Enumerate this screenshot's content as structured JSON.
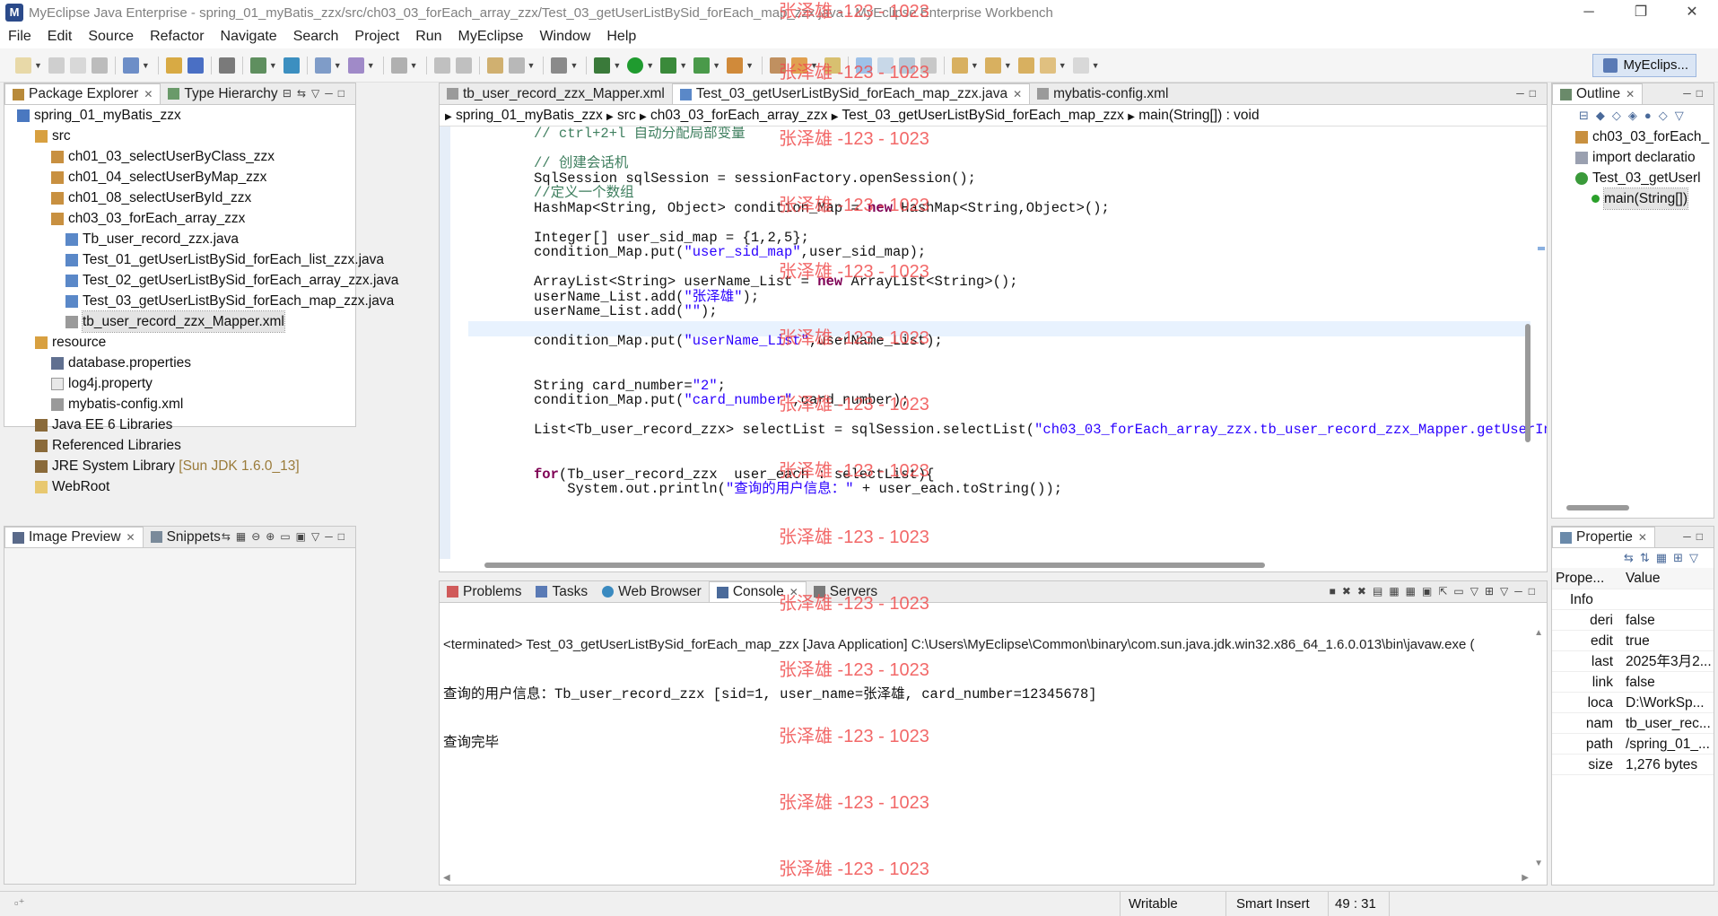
{
  "window": {
    "title": "MyEclipse Java Enterprise - spring_01_myBatis_zzx/src/ch03_03_forEach_array_zzx/Test_03_getUserListBySid_forEach_map_zzx.java - MyEclipse Enterprise Workbench",
    "minimize": "─",
    "maximize": "❐",
    "close": "✕"
  },
  "menu": [
    "File",
    "Edit",
    "Source",
    "Refactor",
    "Navigate",
    "Search",
    "Project",
    "Run",
    "MyEclipse",
    "Window",
    "Help"
  ],
  "toolbar": {
    "perspective": "MyEclips..."
  },
  "package_explorer": {
    "tabs": [
      "Package Explorer",
      "Type Hierarchy"
    ],
    "nodes": [
      {
        "label": "spring_01_myBatis_zzx"
      },
      {
        "label": "src"
      },
      {
        "label": "ch01_03_selectUserByClass_zzx"
      },
      {
        "label": "ch01_04_selectUserByMap_zzx"
      },
      {
        "label": "ch01_08_selectUserById_zzx"
      },
      {
        "label": "ch03_03_forEach_array_zzx"
      },
      {
        "label": "Tb_user_record_zzx.java"
      },
      {
        "label": "Test_01_getUserListBySid_forEach_list_zzx.java"
      },
      {
        "label": "Test_02_getUserListBySid_forEach_array_zzx.java"
      },
      {
        "label": "Test_03_getUserListBySid_forEach_map_zzx.java"
      },
      {
        "label": "tb_user_record_zzx_Mapper.xml"
      },
      {
        "label": "resource"
      },
      {
        "label": "database.properties"
      },
      {
        "label": "log4j.property"
      },
      {
        "label": "mybatis-config.xml"
      },
      {
        "label": "Java EE 6 Libraries"
      },
      {
        "label": "Referenced Libraries"
      },
      {
        "label": "JRE System Library",
        "hint": "[Sun JDK 1.6.0_13]"
      },
      {
        "label": "WebRoot"
      }
    ]
  },
  "image_preview": {
    "tabs": [
      "Image Preview",
      "Snippets"
    ]
  },
  "editor": {
    "tabs": [
      "tb_user_record_zzx_Mapper.xml",
      "Test_03_getUserListBySid_forEach_map_zzx.java",
      "mybatis-config.xml"
    ],
    "breadcrumb": [
      "spring_01_myBatis_zzx",
      "src",
      "ch03_03_forEach_array_zzx",
      "Test_03_getUserListBySid_forEach_map_zzx",
      "main(String[]) : void"
    ],
    "lines": [
      [
        {
          "t": "// ctrl+2+l 自动分配局部变量",
          "c": "cmt"
        }
      ],
      [
        {
          "t": "",
          "c": ""
        }
      ],
      [
        {
          "t": "// 创建会话机",
          "c": "cmt"
        }
      ],
      [
        {
          "t": "SqlSession sqlSession = sessionFactory.openSession();",
          "c": ""
        }
      ],
      [
        {
          "t": "//定义一个数组",
          "c": "cmt"
        }
      ],
      [
        {
          "t": "HashMap<String, Object> condition_Map = ",
          "c": ""
        },
        {
          "t": "new",
          "c": "kw"
        },
        {
          "t": " HashMap<String,Object>();",
          "c": ""
        }
      ],
      [
        {
          "t": "",
          "c": ""
        }
      ],
      [
        {
          "t": "Integer[] user_sid_map = {1,2,5};",
          "c": ""
        }
      ],
      [
        {
          "t": "condition_Map.put(",
          "c": ""
        },
        {
          "t": "\"user_sid_map\"",
          "c": "str"
        },
        {
          "t": ",user_sid_map);",
          "c": ""
        }
      ],
      [
        {
          "t": "",
          "c": ""
        }
      ],
      [
        {
          "t": "ArrayList<String> userName_List = ",
          "c": ""
        },
        {
          "t": "new",
          "c": "kw"
        },
        {
          "t": " ArrayList<String>();",
          "c": ""
        }
      ],
      [
        {
          "t": "userName_List.add(",
          "c": ""
        },
        {
          "t": "\"张泽雄\"",
          "c": "str"
        },
        {
          "t": ");",
          "c": ""
        }
      ],
      [
        {
          "t": "userName_List.add(",
          "c": ""
        },
        {
          "t": "\"\"",
          "c": "str"
        },
        {
          "t": ");",
          "c": ""
        }
      ],
      [
        {
          "t": "",
          "c": ""
        }
      ],
      [
        {
          "t": "condition_Map.put(",
          "c": ""
        },
        {
          "t": "\"userName_List\"",
          "c": "str"
        },
        {
          "t": ",userName_List);",
          "c": ""
        }
      ],
      [
        {
          "t": "",
          "c": ""
        }
      ],
      [
        {
          "t": "",
          "c": ""
        }
      ],
      [
        {
          "t": "String card_number=",
          "c": ""
        },
        {
          "t": "\"2\"",
          "c": "str"
        },
        {
          "t": ";",
          "c": ""
        }
      ],
      [
        {
          "t": "condition_Map.put(",
          "c": ""
        },
        {
          "t": "\"card_number\"",
          "c": "str"
        },
        {
          "t": ",card_number);",
          "c": ""
        }
      ],
      [
        {
          "t": "",
          "c": ""
        }
      ],
      [
        {
          "t": "List<Tb_user_record_zzx> selectList = sqlSession.selectList(",
          "c": ""
        },
        {
          "t": "\"ch03_03_forEach_array_zzx.tb_user_record_zzx_Mapper.getUserIn",
          "c": "str"
        }
      ],
      [
        {
          "t": "",
          "c": ""
        }
      ],
      [
        {
          "t": "",
          "c": ""
        }
      ],
      [
        {
          "t": "for",
          "c": "kw"
        },
        {
          "t": "(Tb_user_record_zzx  user_each : selectList){",
          "c": ""
        }
      ],
      [
        {
          "t": "    System.out.println(",
          "c": ""
        },
        {
          "t": "\"查询的用户信息：\"",
          "c": "str"
        },
        {
          "t": " + user_each.toString());",
          "c": ""
        }
      ]
    ]
  },
  "outline": {
    "tabs": [
      "Outline"
    ],
    "items": [
      "ch03_03_forEach_",
      "import declaratio",
      "Test_03_getUserl",
      "main(String[])"
    ]
  },
  "bottom": {
    "tabs": [
      "Problems",
      "Tasks",
      "Web Browser",
      "Console",
      "Servers"
    ],
    "terminated": "<terminated> Test_03_getUserListBySid_forEach_map_zzx [Java Application] C:\\Users\\MyEclipse\\Common\\binary\\com.sun.java.jdk.win32.x86_64_1.6.0.013\\bin\\javaw.exe (",
    "output": [
      "查询的用户信息：Tb_user_record_zzx [sid=1, user_name=张泽雄, card_number=12345678]",
      "查询完毕"
    ]
  },
  "properties": {
    "tabs": [
      "Propertie"
    ],
    "col_prop": "Prope...",
    "col_value": "Value",
    "group": "Info",
    "rows": [
      {
        "k": "deri",
        "v": "false"
      },
      {
        "k": "edit",
        "v": "true"
      },
      {
        "k": "last",
        "v": "2025年3月2..."
      },
      {
        "k": "link",
        "v": "false"
      },
      {
        "k": "loca",
        "v": "D:\\WorkSp..."
      },
      {
        "k": "nam",
        "v": "tb_user_rec..."
      },
      {
        "k": "path",
        "v": "/spring_01_..."
      },
      {
        "k": "size",
        "v": "1,276  bytes"
      }
    ]
  },
  "status": {
    "writable": "Writable",
    "insert": "Smart Insert",
    "position": "49 : 31"
  },
  "watermark": "张泽雄 -123 - 1023",
  "colors": {
    "keyword": "#7f0055",
    "string": "#2a00ff",
    "comment": "#3f7f5f",
    "watermark": "#f04e4e",
    "selection": "#e8f2fe"
  }
}
